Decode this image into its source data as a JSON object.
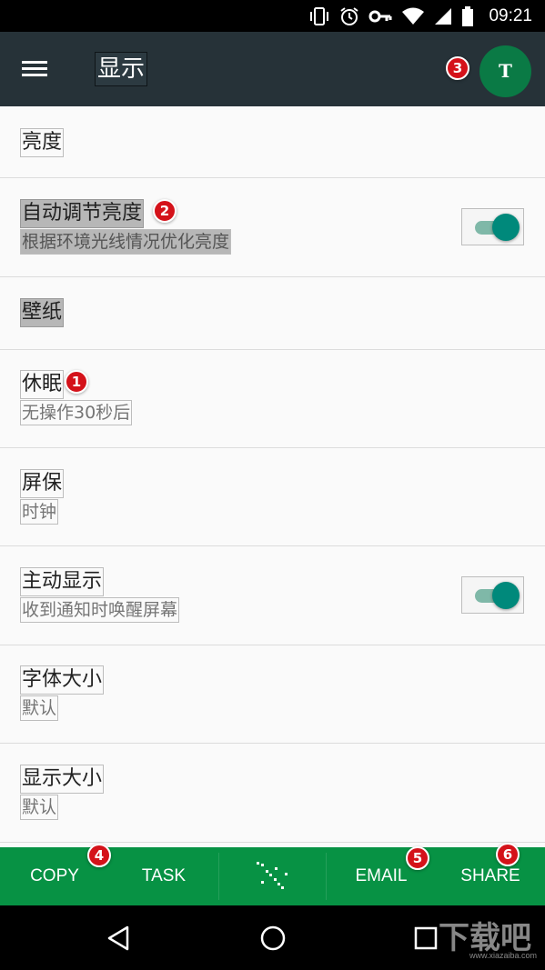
{
  "status_bar": {
    "time": "09:21",
    "icons": [
      "vibrate-icon",
      "alarm-icon",
      "vpn-key-icon",
      "wifi-icon",
      "signal-icon",
      "battery-icon"
    ]
  },
  "app_bar": {
    "title": "显示",
    "avatar_letter": "T",
    "avatar_color": "#0a7a45",
    "background": "#263238"
  },
  "settings": [
    {
      "title": "亮度"
    },
    {
      "title": "自动调节亮度",
      "subtitle": "根据环境光线情况优化亮度",
      "toggle_on": true,
      "highlighted": true
    },
    {
      "title": "壁纸",
      "highlighted": true
    },
    {
      "title": "休眠",
      "subtitle": "无操作30秒后"
    },
    {
      "title": "屏保",
      "subtitle": "时钟"
    },
    {
      "title": "主动显示",
      "subtitle": "收到通知时唤醒屏幕",
      "toggle_on": true
    },
    {
      "title": "字体大小",
      "subtitle": "默认"
    },
    {
      "title": "显示大小",
      "subtitle": "默认"
    }
  ],
  "badges": [
    "1",
    "2",
    "3",
    "4",
    "5",
    "6"
  ],
  "action_bar": {
    "copy": "COPY",
    "task": "TASK",
    "email": "EMAIL",
    "share": "SHARE",
    "center_icon": "drag-dots-icon",
    "background": "#079244"
  },
  "nav_bar": {
    "icons": [
      "back-icon",
      "home-icon",
      "recents-icon"
    ]
  },
  "watermark": {
    "main": "下载吧",
    "sub": "www.xiazaiba.com"
  },
  "accent_color": "#00897b"
}
